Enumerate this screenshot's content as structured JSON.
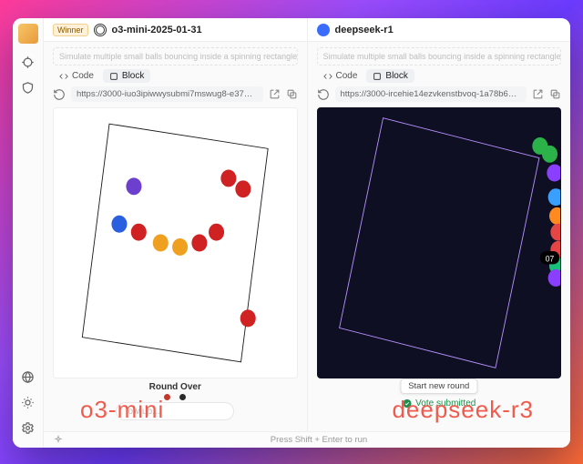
{
  "rail": {
    "icons_top": [
      "avatar",
      "crosshair-icon",
      "shield-icon"
    ],
    "icons_bottom": [
      "globe-icon",
      "sun-icon",
      "gear-icon"
    ]
  },
  "left": {
    "winner_badge": "Winner",
    "model": "o3-mini-2025-01-31",
    "prompt_preview": "Simulate multiple small balls bouncing inside a spinning rectangle",
    "tabs": {
      "code": "Code",
      "block": "Block"
    },
    "url": "https://3000-iuo3ipiwwysubmi7mswug8-e37d0262.e2b-foxtrot.dev",
    "sim": {
      "bg": "#ffffff",
      "rect_stroke": "#1a1a1a",
      "rect_rotation_deg": 8,
      "balls": [
        {
          "cx": 0.33,
          "cy": 0.29,
          "color": "#6d3fcf"
        },
        {
          "cx": 0.72,
          "cy": 0.26,
          "color": "#d02222"
        },
        {
          "cx": 0.78,
          "cy": 0.3,
          "color": "#d02222"
        },
        {
          "cx": 0.27,
          "cy": 0.43,
          "color": "#2a5fe0"
        },
        {
          "cx": 0.35,
          "cy": 0.46,
          "color": "#d02222"
        },
        {
          "cx": 0.44,
          "cy": 0.5,
          "color": "#f0a020"
        },
        {
          "cx": 0.52,
          "cy": 0.515,
          "color": "#f0a020"
        },
        {
          "cx": 0.6,
          "cy": 0.5,
          "color": "#d02222"
        },
        {
          "cx": 0.67,
          "cy": 0.46,
          "color": "#d02222"
        },
        {
          "cx": 0.8,
          "cy": 0.78,
          "color": "#d02222"
        }
      ]
    },
    "round_over": "Round Over",
    "round_dots": [
      "#c1392b",
      "#2a2a2a"
    ],
    "followup_placeholder": "low up...",
    "caption": "o3-mini"
  },
  "right": {
    "model": "deepseek-r1",
    "prompt_preview": "Simulate multiple small balls bouncing inside a spinning rectangle",
    "tabs": {
      "code": "Code",
      "block": "Block"
    },
    "url": "https://3000-ircehie14ezvkenstbvoq-1a78b608.e2b-foxtrot.dev",
    "sim": {
      "bg": "#0f0f23",
      "rect_stroke": "#b892ff",
      "rect_rotation_deg": 13,
      "balls": [
        {
          "cx": 0.915,
          "cy": 0.14,
          "color": "#2bb34a"
        },
        {
          "cx": 0.955,
          "cy": 0.17,
          "color": "#2bb34a"
        },
        {
          "cx": 0.975,
          "cy": 0.24,
          "color": "#8a3fff"
        },
        {
          "cx": 0.98,
          "cy": 0.33,
          "color": "#3aa0ff"
        },
        {
          "cx": 0.985,
          "cy": 0.4,
          "color": "#ff8a1f"
        },
        {
          "cx": 0.99,
          "cy": 0.46,
          "color": "#e64545"
        },
        {
          "cx": 0.99,
          "cy": 0.525,
          "color": "#e64545"
        },
        {
          "cx": 0.985,
          "cy": 0.585,
          "color": "#18c27a"
        },
        {
          "cx": 0.98,
          "cy": 0.63,
          "color": "#8a3fff"
        }
      ],
      "label_bubble": {
        "cx": 0.955,
        "cy": 0.555,
        "text": "07"
      }
    },
    "start_label": "Start new round",
    "vote_submitted": "Vote submitted",
    "caption": "deepseek-r3"
  },
  "statusbar": {
    "hint": "Press  Shift + Enter  to run"
  },
  "colors": {
    "accent_caption": "#ef5b4c",
    "vote_green": "#1f8f4e"
  }
}
